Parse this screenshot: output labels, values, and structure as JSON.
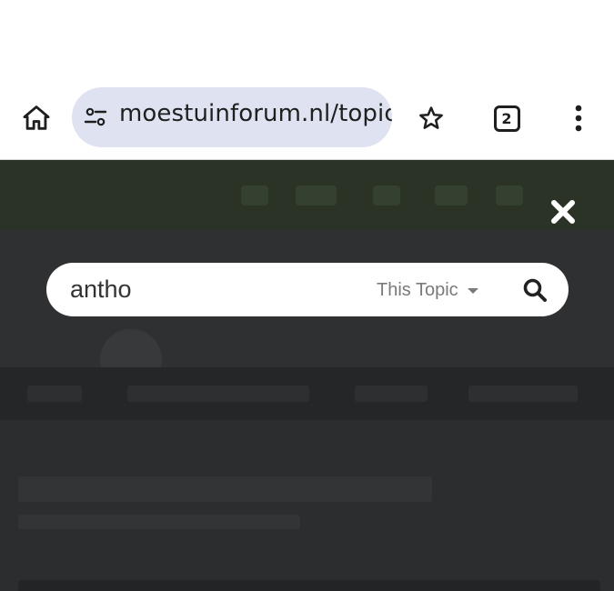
{
  "browser": {
    "url": "moestuinforum.nl/topic",
    "tab_count": "2"
  },
  "search": {
    "query": "antho",
    "scope_label": "This Topic"
  },
  "icons": {
    "home": "home-icon",
    "site_info": "tune-icon",
    "bookmark": "star-icon",
    "tabs": "tab-switcher-icon",
    "menu": "more-vert-icon",
    "close": "close-icon",
    "search": "search-icon",
    "dropdown": "caret-down-icon"
  },
  "colors": {
    "url_pill": "#dfe3f1",
    "overlay_dim": "#2d2e30",
    "scope_text": "#7a7a7a"
  }
}
